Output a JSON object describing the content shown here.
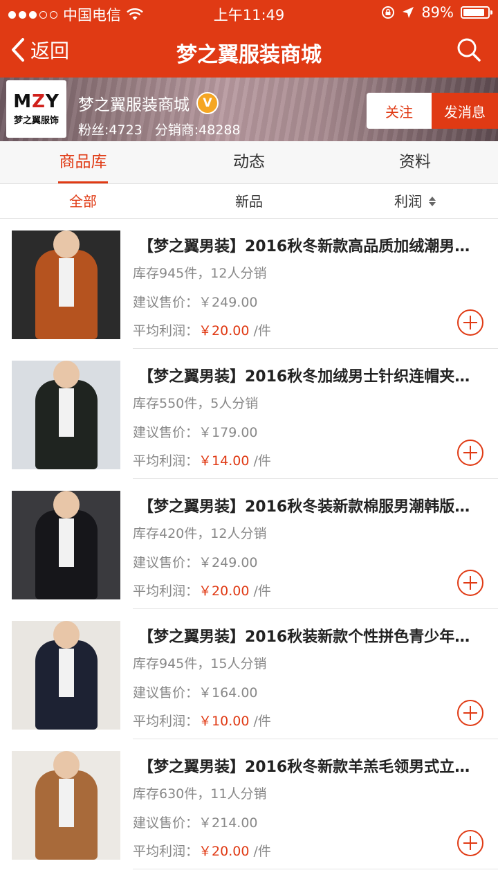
{
  "status_bar": {
    "carrier": "中国电信",
    "time": "上午11:49",
    "battery": "89%",
    "battery_level": 0.89,
    "signal_dots_filled": 3,
    "signal_dots_total": 5
  },
  "nav": {
    "back_label": "返回",
    "title": "梦之翼服装商城"
  },
  "shop": {
    "logo_text": "MZY",
    "logo_subtitle": "梦之翼服饰",
    "name": "梦之翼服装商城",
    "badge": "V",
    "fans_label": "粉丝:4723",
    "distributors_label": "分销商:48288",
    "follow_label": "关注",
    "message_label": "发消息"
  },
  "tabs": [
    {
      "label": "商品库",
      "active": true
    },
    {
      "label": "动态",
      "active": false
    },
    {
      "label": "资料",
      "active": false
    }
  ],
  "filters": [
    {
      "label": "全部",
      "active": true
    },
    {
      "label": "新品",
      "active": false
    },
    {
      "label": "利润",
      "active": false,
      "sortable": true
    }
  ],
  "products": [
    {
      "title": "【梦之翼男装】2016秋冬新款高品质加绒潮男…",
      "stock": "库存945件，12人分销",
      "price_label": "建议售价：",
      "price": "￥249.00",
      "profit_label": "平均利润：",
      "profit": "￥20.00",
      "profit_unit": "/件",
      "thumb_bg": "#2b2b2b",
      "thumb_jacket": "#b5531f"
    },
    {
      "title": "【梦之翼男装】2016秋冬加绒男士针织连帽夹…",
      "stock": "库存550件，5人分销",
      "price_label": "建议售价：",
      "price": "￥179.00",
      "profit_label": "平均利润：",
      "profit": "￥14.00",
      "profit_unit": "/件",
      "thumb_bg": "#d9dde2",
      "thumb_jacket": "#1f2420"
    },
    {
      "title": "【梦之翼男装】2016秋冬装新款棉服男潮韩版…",
      "stock": "库存420件，12人分销",
      "price_label": "建议售价：",
      "price": "￥249.00",
      "profit_label": "平均利润：",
      "profit": "￥20.00",
      "profit_unit": "/件",
      "thumb_bg": "#3a3a3e",
      "thumb_jacket": "#16161a"
    },
    {
      "title": "【梦之翼男装】2016秋装新款个性拼色青少年…",
      "stock": "库存945件，15人分销",
      "price_label": "建议售价：",
      "price": "￥164.00",
      "profit_label": "平均利润：",
      "profit": "￥10.00",
      "profit_unit": "/件",
      "thumb_bg": "#e9e6e1",
      "thumb_jacket": "#1d2233"
    },
    {
      "title": "【梦之翼男装】2016秋冬新款羊羔毛领男式立…",
      "stock": "库存630件，11人分销",
      "price_label": "建议售价：",
      "price": "￥214.00",
      "profit_label": "平均利润：",
      "profit": "￥20.00",
      "profit_unit": "/件",
      "thumb_bg": "#ece9e4",
      "thumb_jacket": "#a86a3a"
    }
  ],
  "colors": {
    "brand": "#e03a14",
    "price_red": "#e03a14"
  },
  "icons": {
    "back": "chevron-left-icon",
    "search": "search-icon",
    "wifi": "wifi-icon",
    "lock": "rotation-lock-icon",
    "location": "location-arrow-icon",
    "add": "add-circle-icon"
  }
}
